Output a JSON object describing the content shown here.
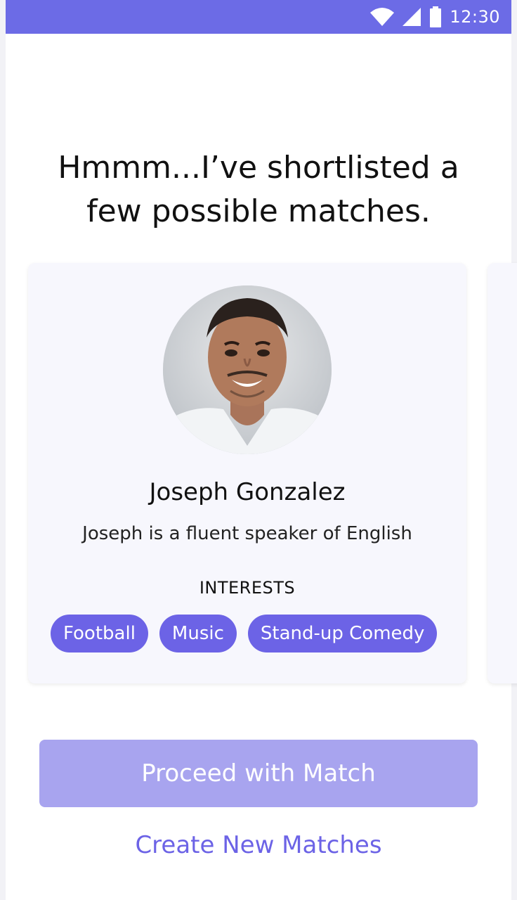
{
  "status_bar": {
    "time": "12:30",
    "icons": [
      "wifi-icon",
      "signal-icon",
      "battery-icon"
    ]
  },
  "headline": "Hmmm...I’ve shortlisted a few possible matches.",
  "matches": [
    {
      "name": "Joseph Gonzalez",
      "description": "Joseph is a fluent speaker of English",
      "interests_title": "INTERESTS",
      "interests": [
        "Football",
        "Music",
        "Stand-up Comedy"
      ]
    }
  ],
  "actions": {
    "proceed_label": "Proceed with Match",
    "create_label": "Create New Matches"
  },
  "colors": {
    "brand": "#6c6be6",
    "chip": "#6c63e6",
    "button_disabled": "#a8a4ef",
    "card_bg": "#f7f7fd"
  }
}
